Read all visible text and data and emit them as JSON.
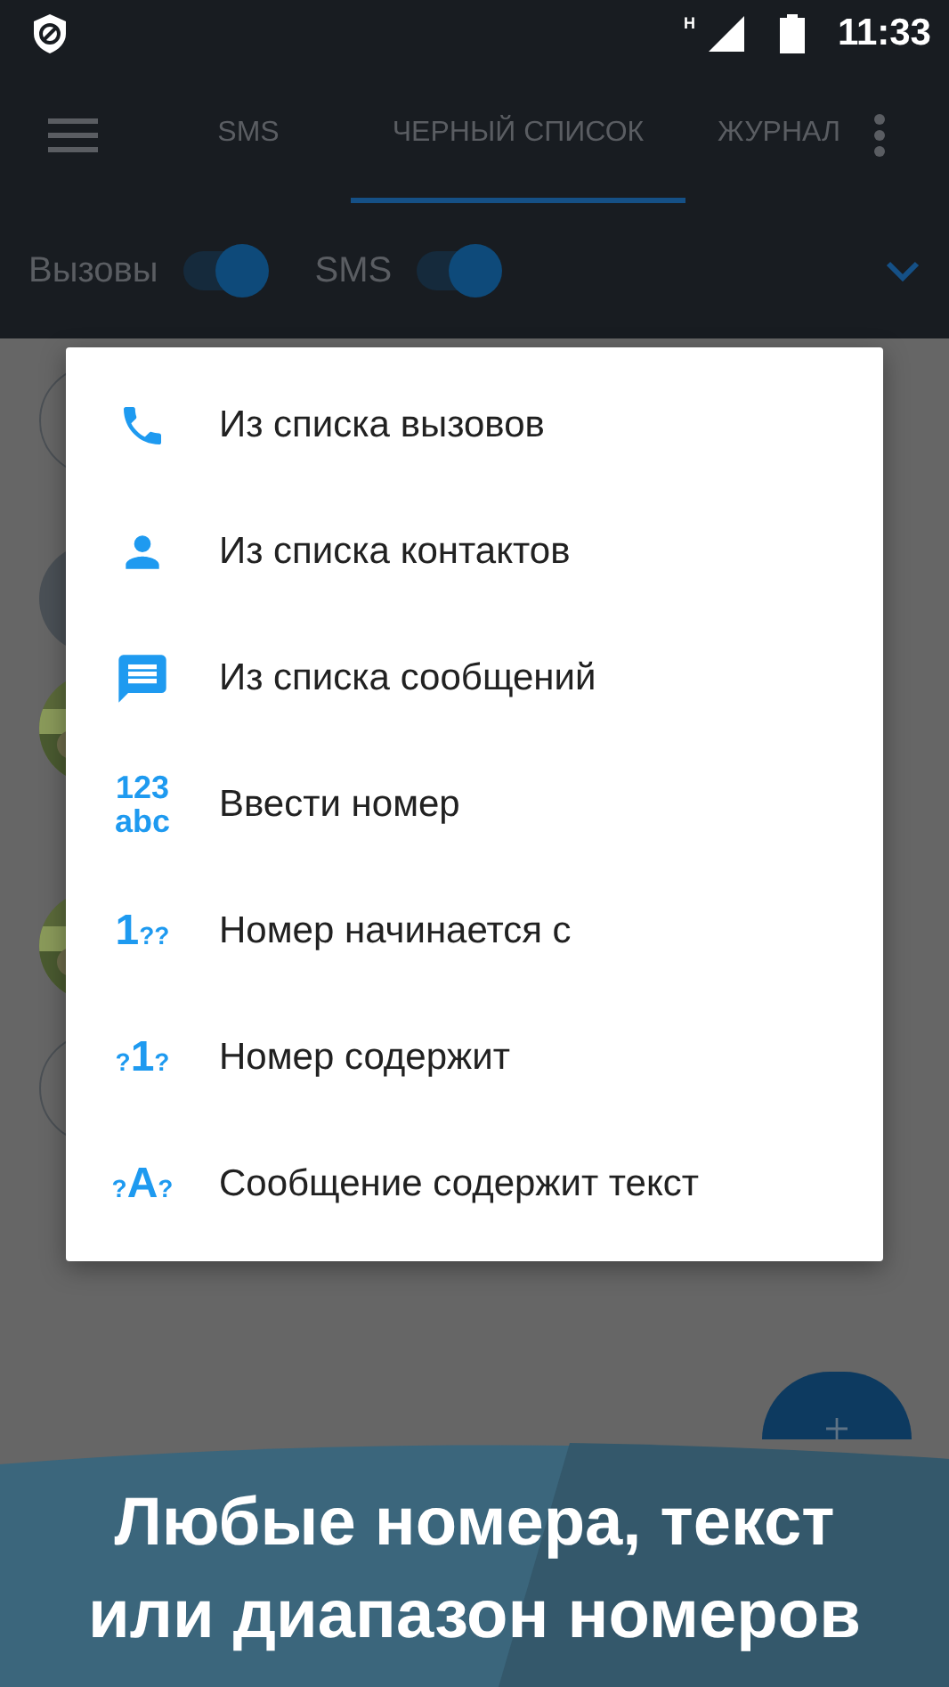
{
  "status_bar": {
    "network": "H",
    "time": "11:33"
  },
  "tabs": [
    {
      "label": "SMS",
      "selected": false
    },
    {
      "label": "ЧЕРНЫЙ СПИСОК",
      "selected": true
    },
    {
      "label": "ЖУРНАЛ",
      "selected": false
    }
  ],
  "filters": [
    {
      "label": "Вызовы",
      "on": true
    },
    {
      "label": "SMS",
      "on": true
    }
  ],
  "menu": [
    {
      "kind": "phone",
      "label": "Из списка вызовов"
    },
    {
      "kind": "contact",
      "label": "Из списка контактов"
    },
    {
      "kind": "message",
      "label": "Из списка сообщений"
    },
    {
      "kind": "glyph",
      "glyph": [
        {
          "text": "123",
          "big": false
        },
        {
          "text": "abc",
          "big": false
        }
      ],
      "stacked": true,
      "label": "Ввести номер"
    },
    {
      "kind": "glyph",
      "glyph": [
        {
          "text": "1",
          "big": true
        },
        {
          "text": "??",
          "big": false
        }
      ],
      "label": "Номер начинается с"
    },
    {
      "kind": "glyph",
      "glyph": [
        {
          "text": "?",
          "big": false
        },
        {
          "text": "1",
          "big": true
        },
        {
          "text": "?",
          "big": false
        }
      ],
      "label": "Номер содержит"
    },
    {
      "kind": "glyph",
      "glyph": [
        {
          "text": "?",
          "big": false
        },
        {
          "text": "A",
          "big": true
        },
        {
          "text": "?",
          "big": false
        }
      ],
      "label": "Сообщение содержит текст"
    }
  ],
  "banner": {
    "lines": [
      "Любые номера, текст",
      "или диапазон номеров"
    ]
  }
}
